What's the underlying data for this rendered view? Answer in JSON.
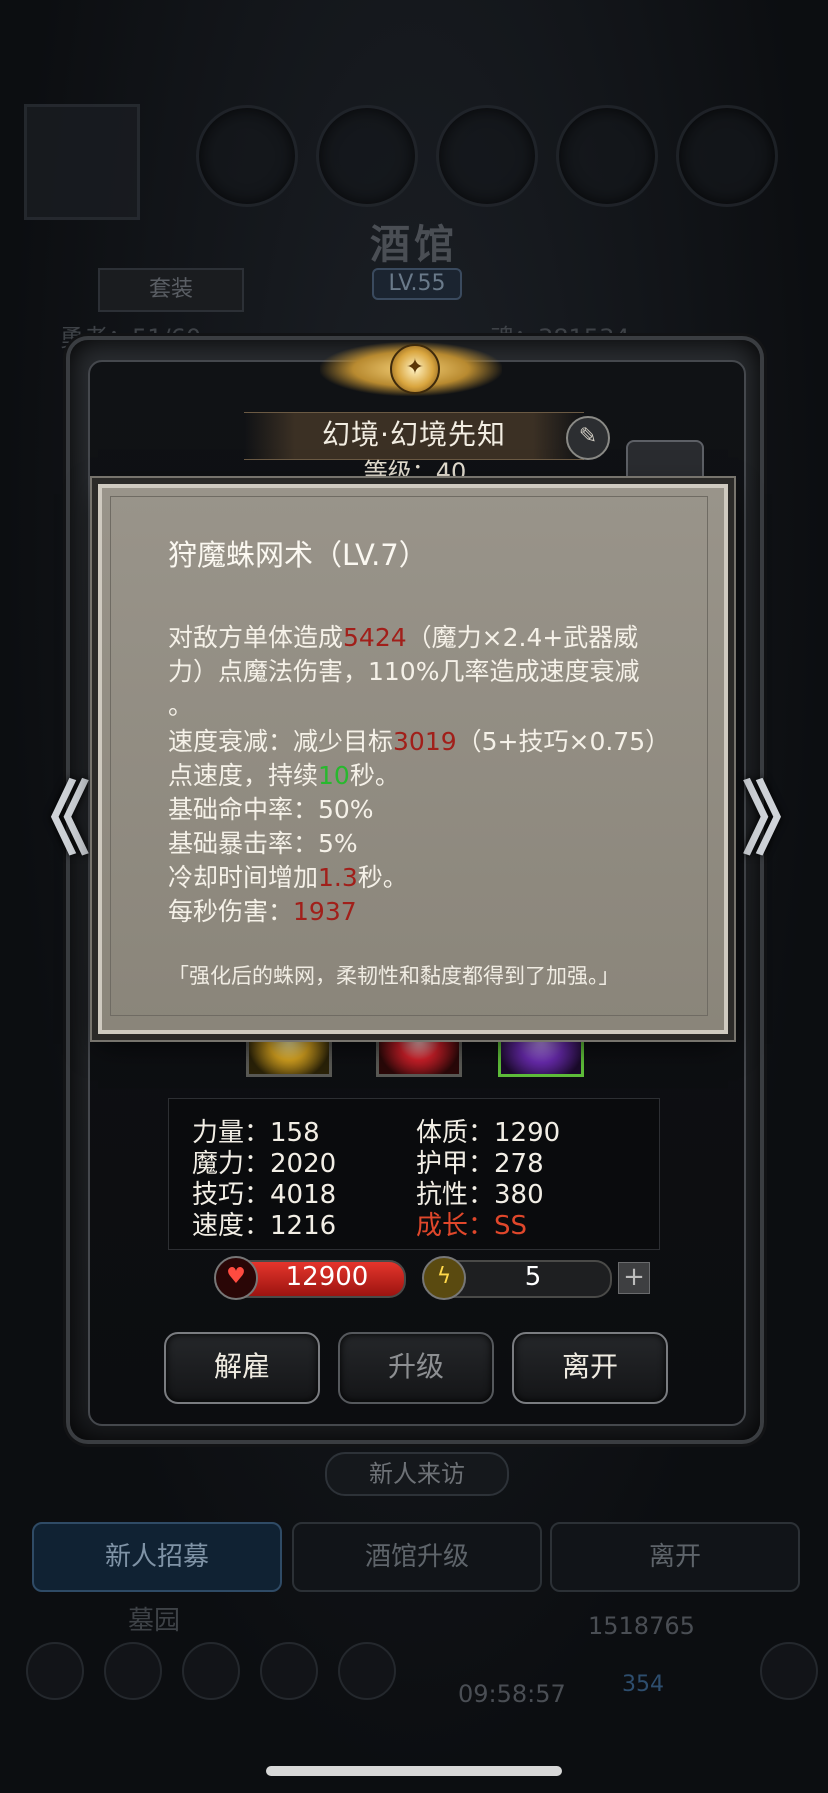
{
  "background": {
    "tavern_title": "酒馆",
    "tavern_level": "LV.55",
    "suit_button": "套装",
    "hero_count": "勇者：51/60",
    "soul": "魂：381534",
    "new_visitor": "新人来访",
    "buttons": [
      "新人招募",
      "酒馆升级",
      "离开"
    ],
    "tomb": "墓园",
    "gold": "1518765",
    "gem": "354",
    "timer": "09:58:57"
  },
  "hero": {
    "name": "幻境·幻境先知",
    "level": "等级：40",
    "edit_icon": "pencil-icon",
    "stats": {
      "strength": "力量：158",
      "magic": "魔力：2020",
      "skill": "技巧：4018",
      "speed": "速度：1216",
      "constitution": "体质：1290",
      "armor": "护甲：278",
      "resistance": "抗性：380",
      "growth": "成长：SS"
    },
    "hp": "12900",
    "energy": "5",
    "plus": "+",
    "actions": {
      "dismiss": "解雇",
      "upgrade": "升级",
      "leave": "离开"
    },
    "colors": {
      "growth": "#e0472b",
      "hp": "#d2251e"
    }
  },
  "nav": {
    "prev": "《",
    "next": "》"
  },
  "tooltip": {
    "title": "狩魔蛛网术（LV.7）",
    "l1_a": "对敌方单体造成",
    "l1_val": "5424",
    "l1_b": "（魔力×2.4+武器威",
    "l2": "力）点魔法伤害，110%几率造成速度衰减",
    "l3": "。",
    "l4_a": "速度衰减：减少目标",
    "l4_val": "3019",
    "l4_b": "（5+技巧×0.75）",
    "l5_a": "点速度，持续",
    "l5_val": "10",
    "l5_b": "秒。",
    "l6": "基础命中率：50%",
    "l7": "基础暴击率：5%",
    "l8_a": "冷却时间增加",
    "l8_val": "1.3",
    "l8_b": "秒。",
    "l9_a": "每秒伤害：",
    "l9_val": "1937",
    "quote": "「强化后的蛛网，柔韧性和黏度都得到了加强。」",
    "colors": {
      "value_red": "#a11f1a",
      "value_green": "#28b82e"
    }
  }
}
